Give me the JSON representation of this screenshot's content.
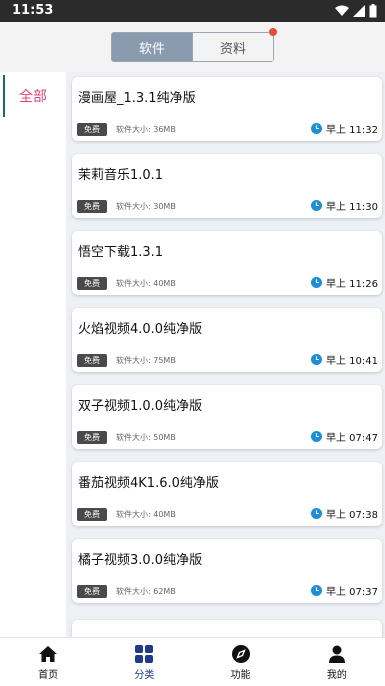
{
  "status_bar": {
    "time": "11:53",
    "icons": [
      "wifi-icon",
      "signal-icon",
      "battery-icon"
    ]
  },
  "segmented": {
    "tabs": [
      {
        "label": "软件",
        "active": true
      },
      {
        "label": "资料",
        "active": false,
        "badge_dot": true
      }
    ],
    "accent": "#8a9bb0",
    "dot_color": "#e74c3c"
  },
  "sidebar": {
    "items": [
      {
        "label": "全部",
        "active": true
      }
    ],
    "active_color": "#e0457b"
  },
  "apps": [
    {
      "title": "漫画屋_1.3.1纯净版",
      "badge": "免费",
      "size": "软件大小: 36MB",
      "time": "早上 11:32"
    },
    {
      "title": "茉莉音乐1.0.1",
      "badge": "免费",
      "size": "软件大小: 30MB",
      "time": "早上 11:30"
    },
    {
      "title": "悟空下载1.3.1",
      "badge": "免费",
      "size": "软件大小: 40MB",
      "time": "早上 11:26"
    },
    {
      "title": "火焰视频4.0.0纯净版",
      "badge": "免费",
      "size": "软件大小: 75MB",
      "time": "早上 10:41"
    },
    {
      "title": "双子视频1.0.0纯净版",
      "badge": "免费",
      "size": "软件大小: 50MB",
      "time": "早上 07:47"
    },
    {
      "title": "番茄视频4K1.6.0纯净版",
      "badge": "免费",
      "size": "软件大小: 40MB",
      "time": "早上 07:38"
    },
    {
      "title": "橘子视频3.0.0纯净版",
      "badge": "免费",
      "size": "软件大小: 62MB",
      "time": "早上 07:37"
    }
  ],
  "bottom_nav": {
    "items": [
      {
        "label": "首页",
        "icon": "home-icon",
        "active": false
      },
      {
        "label": "分类",
        "icon": "grid-icon",
        "active": true
      },
      {
        "label": "功能",
        "icon": "compass-icon",
        "active": false
      },
      {
        "label": "我的",
        "icon": "user-icon",
        "active": false
      }
    ],
    "active_color": "#1f3a8a"
  }
}
